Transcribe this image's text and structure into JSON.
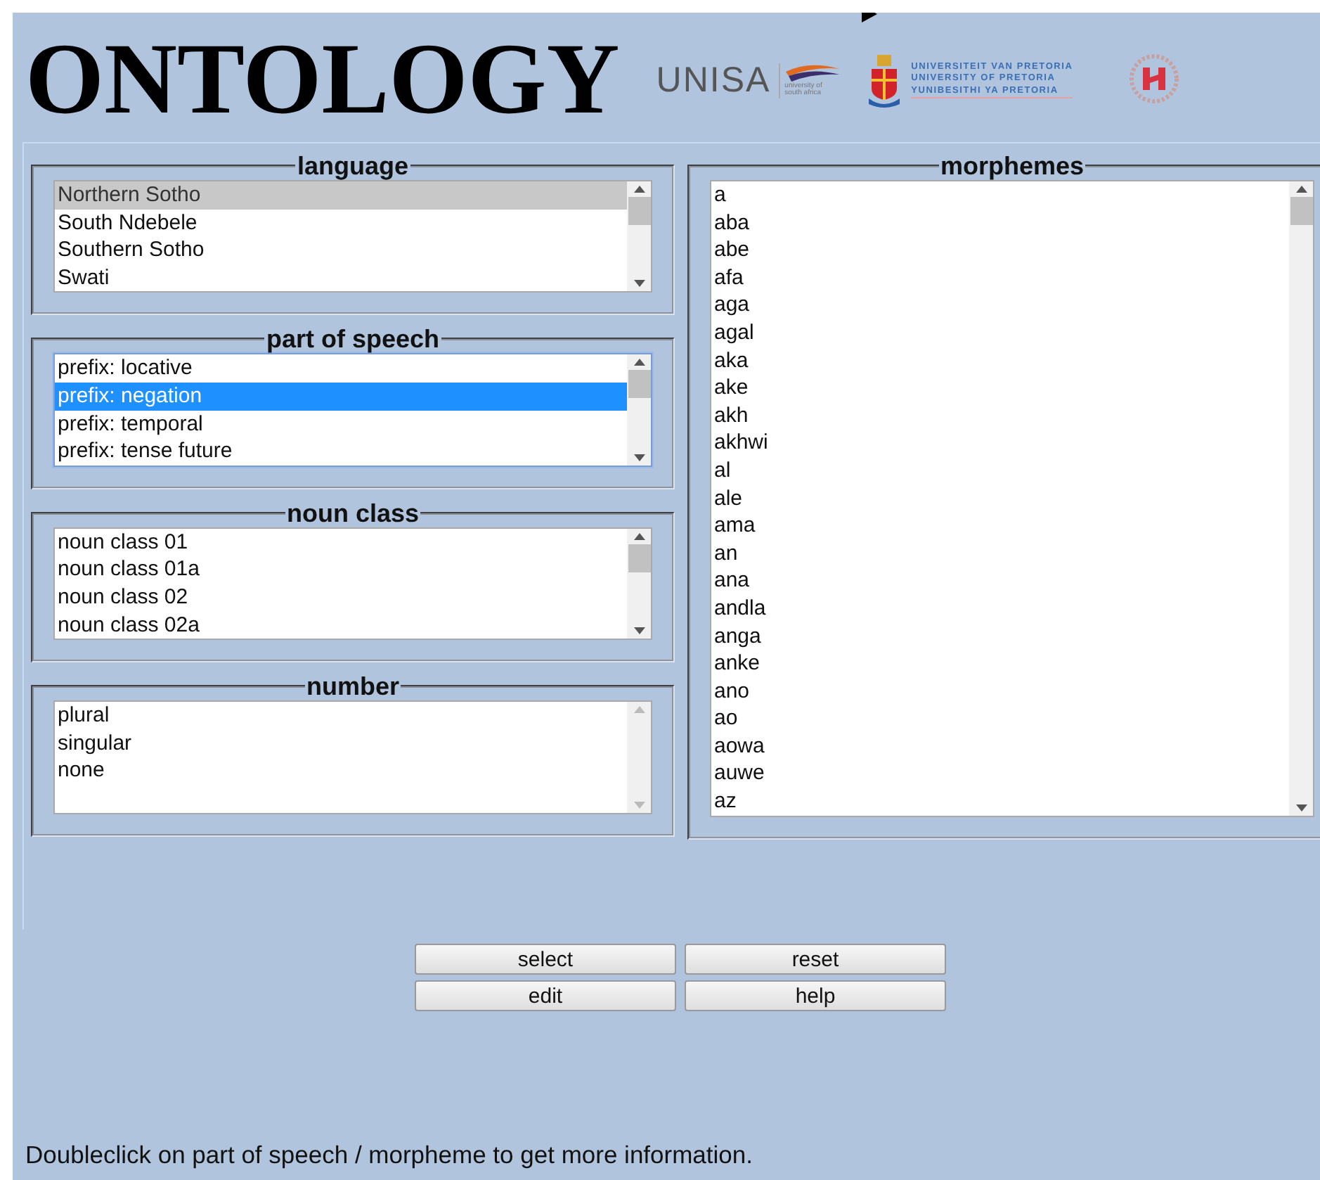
{
  "header": {
    "title": "ONTOLOGY",
    "logos": {
      "unisa": "UNISA",
      "unisa_tagline": "university of south africa",
      "pretoria_lines": [
        "UNIVERSITEIT VAN PRETORIA",
        "UNIVERSITY OF PRETORIA",
        "YUNIBESITHI YA PRETORIA"
      ]
    }
  },
  "left_panels": [
    {
      "legend": "language",
      "focused": false,
      "items": [
        {
          "label": "Northern Sotho",
          "selected": true
        },
        {
          "label": "South Ndebele",
          "selected": false
        },
        {
          "label": "Southern Sotho",
          "selected": false
        },
        {
          "label": "Swati",
          "selected": false
        }
      ]
    },
    {
      "legend": "part of speech",
      "focused": true,
      "items": [
        {
          "label": "prefix: locative",
          "selected": false
        },
        {
          "label": "prefix: negation",
          "selected": true
        },
        {
          "label": "prefix: temporal",
          "selected": false
        },
        {
          "label": "prefix: tense future",
          "selected": false
        }
      ]
    },
    {
      "legend": "noun class",
      "focused": false,
      "items": [
        {
          "label": "noun class 01",
          "selected": false
        },
        {
          "label": "noun class 01a",
          "selected": false
        },
        {
          "label": "noun class 02",
          "selected": false
        },
        {
          "label": "noun class 02a",
          "selected": false
        }
      ]
    },
    {
      "legend": "number",
      "focused": false,
      "items": [
        {
          "label": "plural",
          "selected": false
        },
        {
          "label": "singular",
          "selected": false
        },
        {
          "label": "none",
          "selected": false
        }
      ]
    }
  ],
  "morphemes": {
    "legend": "morphemes",
    "focused": false,
    "items": [
      {
        "label": "a",
        "selected": false
      },
      {
        "label": "aba",
        "selected": false
      },
      {
        "label": "abe",
        "selected": false
      },
      {
        "label": "afa",
        "selected": false
      },
      {
        "label": "aga",
        "selected": false
      },
      {
        "label": "agal",
        "selected": false
      },
      {
        "label": "aka",
        "selected": false
      },
      {
        "label": "ake",
        "selected": false
      },
      {
        "label": "akh",
        "selected": false
      },
      {
        "label": "akhwi",
        "selected": false
      },
      {
        "label": "al",
        "selected": false
      },
      {
        "label": "ale",
        "selected": false
      },
      {
        "label": "ama",
        "selected": false
      },
      {
        "label": "an",
        "selected": false
      },
      {
        "label": "ana",
        "selected": false
      },
      {
        "label": "andla",
        "selected": false
      },
      {
        "label": "anga",
        "selected": false
      },
      {
        "label": "anke",
        "selected": false
      },
      {
        "label": "ano",
        "selected": false
      },
      {
        "label": "ao",
        "selected": false
      },
      {
        "label": "aowa",
        "selected": false
      },
      {
        "label": "auwe",
        "selected": false
      },
      {
        "label": "az",
        "selected": false
      }
    ]
  },
  "buttons": [
    "select",
    "reset",
    "edit",
    "help"
  ],
  "status": "Doubleclick on part of speech / morpheme to get more information."
}
